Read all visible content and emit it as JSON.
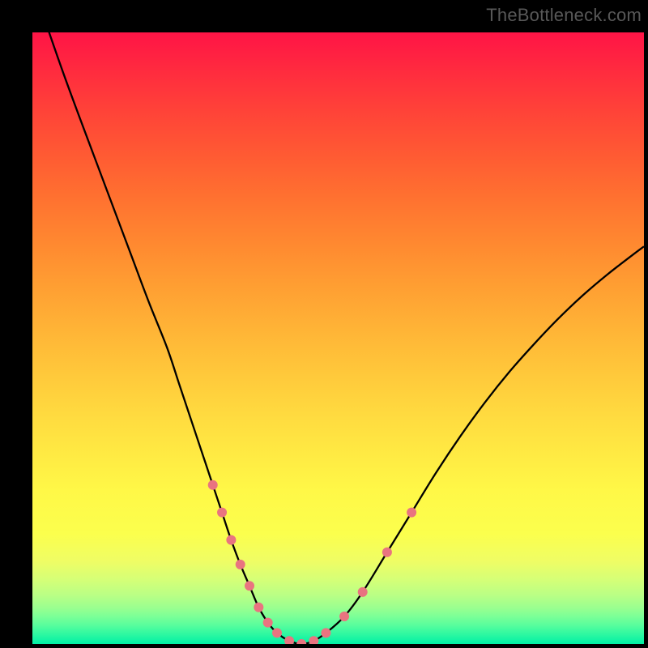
{
  "watermark": "TheBottleneck.com",
  "chart_data": {
    "type": "line",
    "title": "",
    "xlabel": "",
    "ylabel": "",
    "xlim": [
      0,
      100
    ],
    "ylim": [
      0,
      100
    ],
    "x": [
      0,
      5,
      10,
      13,
      16,
      19,
      22,
      24,
      26,
      28,
      29.5,
      31,
      32.5,
      34,
      35.5,
      37,
      38.5,
      40,
      42,
      44,
      46,
      48,
      51,
      54,
      58,
      62,
      66,
      70,
      74,
      78,
      82,
      86,
      90,
      94,
      98,
      100
    ],
    "values": [
      108,
      93.5,
      80,
      72,
      64,
      56,
      48.5,
      42.5,
      36.5,
      30.5,
      26,
      21.5,
      17,
      13,
      9.5,
      6,
      3.5,
      1.8,
      0.5,
      0,
      0.5,
      1.8,
      4.5,
      8.5,
      15,
      21.5,
      28,
      34,
      39.5,
      44.5,
      49,
      53.2,
      57,
      60.4,
      63.5,
      65
    ],
    "highlight_threshold": 27,
    "curve_color": "#000000",
    "dot_color": "#e97480",
    "dot_radius_px": 6
  }
}
